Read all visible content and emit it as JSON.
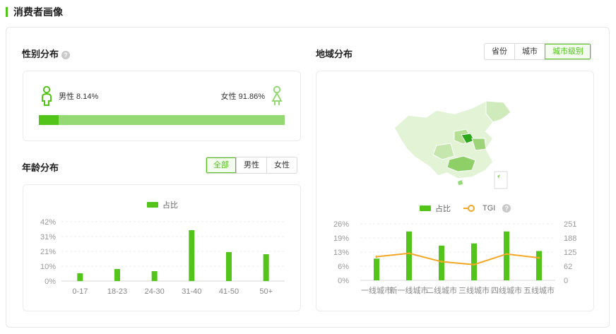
{
  "section_title": "消费者画像",
  "gender": {
    "title": "性别分布",
    "help_icon": "?",
    "male_label": "男性 8.14%",
    "female_label": "女性 91.86%",
    "male_share": 0.0814,
    "colors": {
      "male": "#52c41a",
      "female": "#95d975"
    }
  },
  "age": {
    "title": "年龄分布",
    "tabs": [
      "全部",
      "男性",
      "女性"
    ],
    "active_tab": "全部",
    "legend": "占比"
  },
  "region": {
    "title": "地域分布",
    "tabs": [
      "省份",
      "城市",
      "城市级别"
    ],
    "active_tab": "城市级别",
    "legend_bar": "占比",
    "legend_line": "TGI",
    "help_icon": "?"
  },
  "chart_data": [
    {
      "type": "bar",
      "categories": [
        "0-17",
        "18-23",
        "24-30",
        "31-40",
        "41-50",
        "50+"
      ],
      "series": [
        {
          "name": "占比",
          "values": [
            5.5,
            8.5,
            7.0,
            36.0,
            20.5,
            19.0
          ]
        }
      ],
      "ylim": [
        0,
        42
      ],
      "yticks": [
        "0%",
        "10%",
        "21%",
        "31%",
        "42%"
      ],
      "ytick_values": [
        0,
        10.5,
        21,
        31.5,
        42
      ],
      "grid": true,
      "legend": "top-center",
      "color": "#52c41a"
    },
    {
      "type": "bar",
      "categories": [
        "一线城市",
        "新一线城市",
        "二线城市",
        "三线城市",
        "四线城市",
        "五线城市"
      ],
      "series": [
        {
          "name": "占比",
          "type": "bar",
          "values": [
            10.0,
            22.5,
            16.0,
            17.0,
            22.5,
            13.5
          ]
        },
        {
          "name": "TGI",
          "type": "line",
          "values": [
            105,
            120,
            83,
            70,
            117,
            100
          ]
        }
      ],
      "ylim": [
        0,
        26
      ],
      "yticks": [
        "0%",
        "6%",
        "13%",
        "19%",
        "26%"
      ],
      "ytick_values": [
        0,
        6.5,
        13,
        19.5,
        26
      ],
      "y2lim": [
        0,
        251
      ],
      "y2ticks": [
        "0",
        "62",
        "125",
        "188",
        "251"
      ],
      "y2tick_values": [
        0,
        62.75,
        125.5,
        188.25,
        251
      ],
      "grid": true,
      "legend": "top-center",
      "colors": {
        "bar": "#52c41a",
        "line": "#f5a623"
      }
    }
  ]
}
